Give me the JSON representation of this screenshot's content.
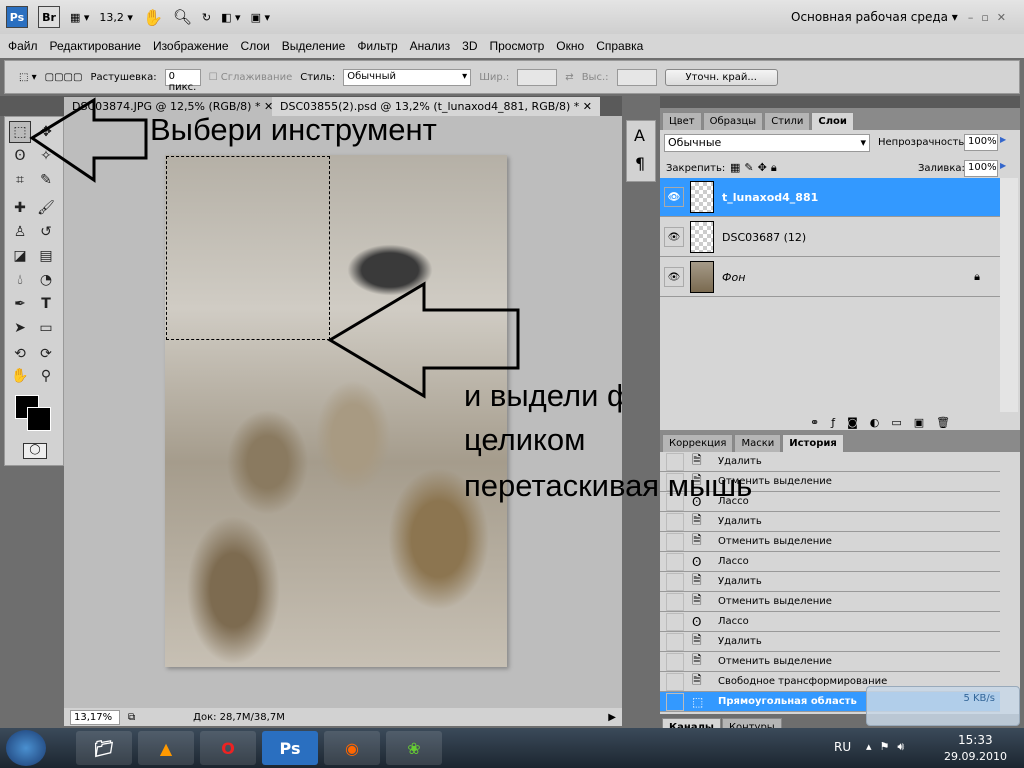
{
  "appbar": {
    "ps": "Ps",
    "br": "Br",
    "zoom": "13,2",
    "workspace": "Основная рабочая среда"
  },
  "menu": [
    "Файл",
    "Редактирование",
    "Изображение",
    "Слои",
    "Выделение",
    "Фильтр",
    "Анализ",
    "3D",
    "Просмотр",
    "Окно",
    "Справка"
  ],
  "options": {
    "feather_label": "Растушевка:",
    "feather_value": "0 пикс.",
    "antialias": "Сглаживание",
    "style_label": "Стиль:",
    "style_value": "Обычный",
    "width_label": "Шир.:",
    "height_label": "Выс.:",
    "refine": "Уточн. край..."
  },
  "doc_tabs": [
    "DSC03874.JPG @ 12,5% (RGB/8) *",
    "DSC03855(2).psd @ 13,2% (t_lunaxod4_881, RGB/8) *"
  ],
  "status": {
    "zoom": "13,17%",
    "doc": "Док: 28,7M/38,7M"
  },
  "layers_panel": {
    "tabs": [
      "Цвет",
      "Образцы",
      "Стили",
      "Слои"
    ],
    "blend": "Обычные",
    "opacity_label": "Непрозрачность:",
    "opacity": "100%",
    "lock_label": "Закрепить:",
    "fill_label": "Заливка:",
    "fill": "100%",
    "layers": [
      {
        "name": "t_lunaxod4_881",
        "selected": true
      },
      {
        "name": "DSC03687 (12)"
      },
      {
        "name": "Фон",
        "locked": true
      }
    ]
  },
  "history_panel": {
    "tabs": [
      "Коррекция",
      "Маски",
      "История"
    ],
    "items": [
      {
        "icon": "doc",
        "label": "Удалить"
      },
      {
        "icon": "doc",
        "label": "Отменить выделение"
      },
      {
        "icon": "lasso",
        "label": "Лассо"
      },
      {
        "icon": "doc",
        "label": "Удалить"
      },
      {
        "icon": "doc",
        "label": "Отменить выделение"
      },
      {
        "icon": "lasso",
        "label": "Лассо"
      },
      {
        "icon": "doc",
        "label": "Удалить"
      },
      {
        "icon": "doc",
        "label": "Отменить выделение"
      },
      {
        "icon": "lasso",
        "label": "Лассо"
      },
      {
        "icon": "doc",
        "label": "Удалить"
      },
      {
        "icon": "doc",
        "label": "Отменить выделение"
      },
      {
        "icon": "doc",
        "label": "Свободное трансформирование"
      },
      {
        "icon": "marquee",
        "label": "Прямоугольная область",
        "selected": true
      }
    ]
  },
  "bottom_tabs": [
    "Каналы",
    "Контуры"
  ],
  "net_widget": {
    "speed": "5 KB/s"
  },
  "annotations": {
    "a1": "Выбери инструмент",
    "a2": "и выдели фотку",
    "a3": "целиком",
    "a4": "перетаскивая мышь"
  },
  "tray": {
    "lang": "RU",
    "time": "15:33",
    "date": "29.09.2010"
  },
  "colors": {
    "accent": "#3399ff"
  }
}
